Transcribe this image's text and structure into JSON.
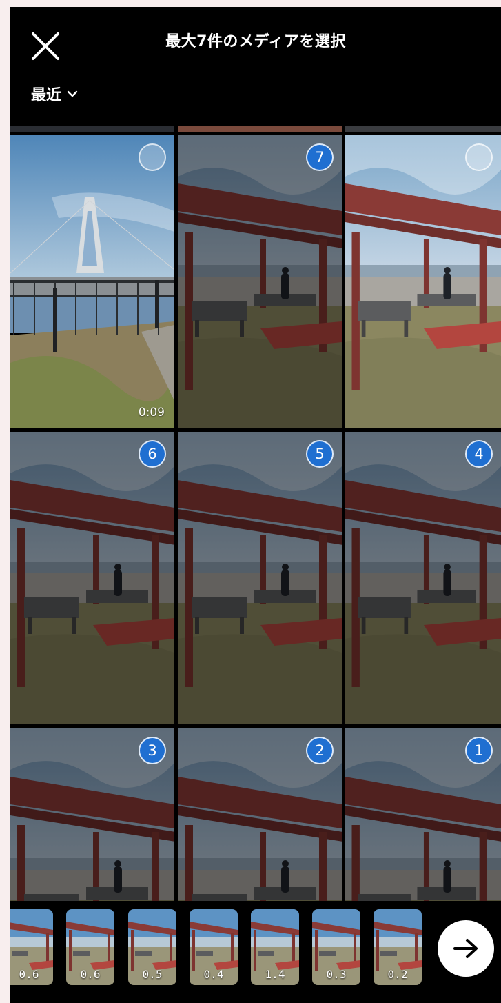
{
  "header": {
    "close_icon": "close-icon",
    "title": "最大7件のメディアを選択",
    "album": {
      "label": "最近",
      "icon": "chevron-down-icon"
    }
  },
  "grid": {
    "items": [
      {
        "kind": "bridge",
        "badge": "",
        "selected": false,
        "duration": "0:09"
      },
      {
        "kind": "pavilion",
        "badge": "7",
        "selected": true,
        "duration": ""
      },
      {
        "kind": "pavilion-bright",
        "badge": "",
        "selected": false,
        "duration": ""
      },
      {
        "kind": "pavilion",
        "badge": "6",
        "selected": true,
        "duration": ""
      },
      {
        "kind": "pavilion",
        "badge": "5",
        "selected": true,
        "duration": ""
      },
      {
        "kind": "pavilion",
        "badge": "4",
        "selected": true,
        "duration": ""
      },
      {
        "kind": "pavilion",
        "badge": "3",
        "selected": true,
        "duration": ""
      },
      {
        "kind": "pavilion",
        "badge": "2",
        "selected": true,
        "duration": ""
      },
      {
        "kind": "pavilion",
        "badge": "1",
        "selected": true,
        "duration": ""
      }
    ]
  },
  "tray": {
    "thumbnails": [
      "0.6",
      "0.6",
      "0.5",
      "0.4",
      "1.4",
      "0.3",
      "0.2"
    ],
    "next_icon": "arrow-right-icon"
  },
  "colors": {
    "badge_blue": "#1f6fd1",
    "roof_red": "#8a3a36",
    "bench_red": "#b3463f"
  }
}
